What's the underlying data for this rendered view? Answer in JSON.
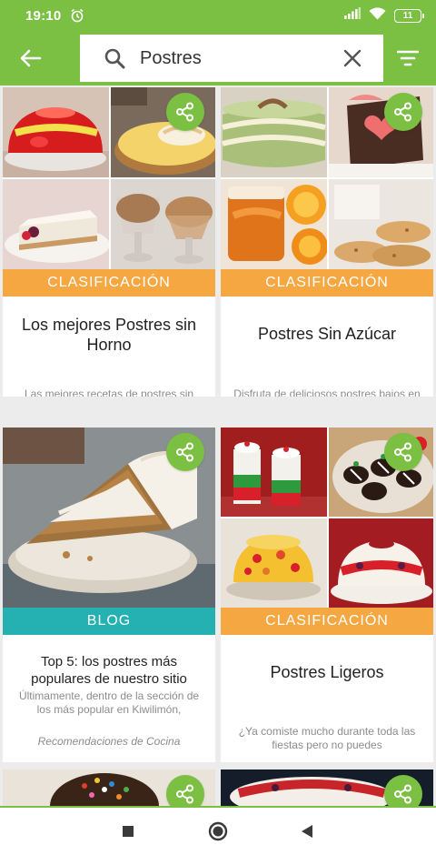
{
  "status_bar": {
    "time": "19:10",
    "battery": "11"
  },
  "search": {
    "query": "Postres"
  },
  "colors": {
    "brand_green": "#7bc043",
    "classification_orange": "#f5a742",
    "blog_teal": "#25b1b1"
  },
  "cards": [
    {
      "category": "CLASIFICACIÓN",
      "title": "Los mejores Postres sin Horno",
      "description": "Las mejores recetas de postres sin horno desde postres hechos"
    },
    {
      "category": "CLASIFICACIÓN",
      "title": "Postres Sin Azúcar",
      "description": "Disfruta de deliciosos postres bajos en calorías por ser libres"
    },
    {
      "category": "BLOG",
      "title": "Top 5: los postres más populares de nuestro sitio",
      "description": "Últimamente, dentro de la sección de los más popular en Kiwilimón,",
      "source": "Recomendaciones de Cocina"
    },
    {
      "category": "CLASIFICACIÓN",
      "title": "Postres Ligeros",
      "description": "¿Ya comiste mucho durante toda las fiestas pero no puedes"
    }
  ]
}
